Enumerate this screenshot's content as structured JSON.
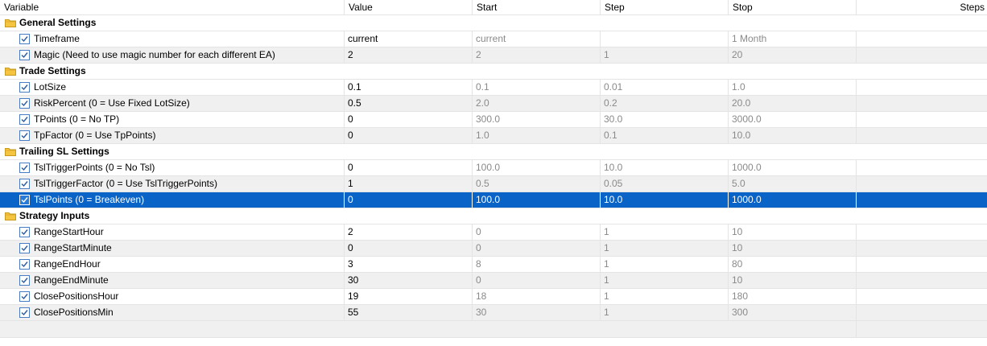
{
  "columns": {
    "variable": "Variable",
    "value": "Value",
    "start": "Start",
    "step": "Step",
    "stop": "Stop",
    "steps": "Steps"
  },
  "groups": [
    {
      "title": "General Settings",
      "params": [
        {
          "name": "Timeframe",
          "value": "current",
          "start": "current",
          "step": "",
          "stop": "1 Month",
          "steps": ""
        },
        {
          "name": "Magic (Need to use magic number for each different EA)",
          "value": "2",
          "start": "2",
          "step": "1",
          "stop": "20",
          "steps": ""
        }
      ]
    },
    {
      "title": "Trade Settings",
      "params": [
        {
          "name": "LotSize",
          "value": "0.1",
          "start": "0.1",
          "step": "0.01",
          "stop": "1.0",
          "steps": ""
        },
        {
          "name": "RiskPercent (0 = Use Fixed LotSize)",
          "value": "0.5",
          "start": "2.0",
          "step": "0.2",
          "stop": "20.0",
          "steps": ""
        },
        {
          "name": "TPoints (0 = No TP)",
          "value": "0",
          "start": "300.0",
          "step": "30.0",
          "stop": "3000.0",
          "steps": ""
        },
        {
          "name": "TpFactor (0 = Use TpPoints)",
          "value": "0",
          "start": "1.0",
          "step": "0.1",
          "stop": "10.0",
          "steps": ""
        }
      ]
    },
    {
      "title": "Trailing SL Settings",
      "params": [
        {
          "name": "TslTriggerPoints (0 = No Tsl)",
          "value": "0",
          "start": "100.0",
          "step": "10.0",
          "stop": "1000.0",
          "steps": ""
        },
        {
          "name": "TslTriggerFactor (0 = Use TslTriggerPoints)",
          "value": "1",
          "start": "0.5",
          "step": "0.05",
          "stop": "5.0",
          "steps": ""
        },
        {
          "name": "TslPoints (0 = Breakeven)",
          "value": "0",
          "start": "100.0",
          "step": "10.0",
          "stop": "1000.0",
          "steps": "",
          "selected": true
        }
      ]
    },
    {
      "title": "Strategy Inputs",
      "params": [
        {
          "name": "RangeStartHour",
          "value": "2",
          "start": "0",
          "step": "1",
          "stop": "10",
          "steps": ""
        },
        {
          "name": "RangeStartMinute",
          "value": "0",
          "start": "0",
          "step": "1",
          "stop": "10",
          "steps": ""
        },
        {
          "name": "RangeEndHour",
          "value": "3",
          "start": "8",
          "step": "1",
          "stop": "80",
          "steps": ""
        },
        {
          "name": "RangeEndMinute",
          "value": "30",
          "start": "0",
          "step": "1",
          "stop": "10",
          "steps": ""
        },
        {
          "name": "ClosePositionsHour",
          "value": "19",
          "start": "18",
          "step": "1",
          "stop": "180",
          "steps": ""
        },
        {
          "name": "ClosePositionsMin",
          "value": "55",
          "start": "30",
          "step": "1",
          "stop": "300",
          "steps": ""
        }
      ]
    }
  ],
  "icons": {
    "group": "folder-icon",
    "param": "checkbox-checked-icon"
  },
  "colors": {
    "selection": "#0a64c8",
    "folder": "#f5c542",
    "check": "#2c5aa0",
    "dim_text": "#8a8a8a"
  }
}
